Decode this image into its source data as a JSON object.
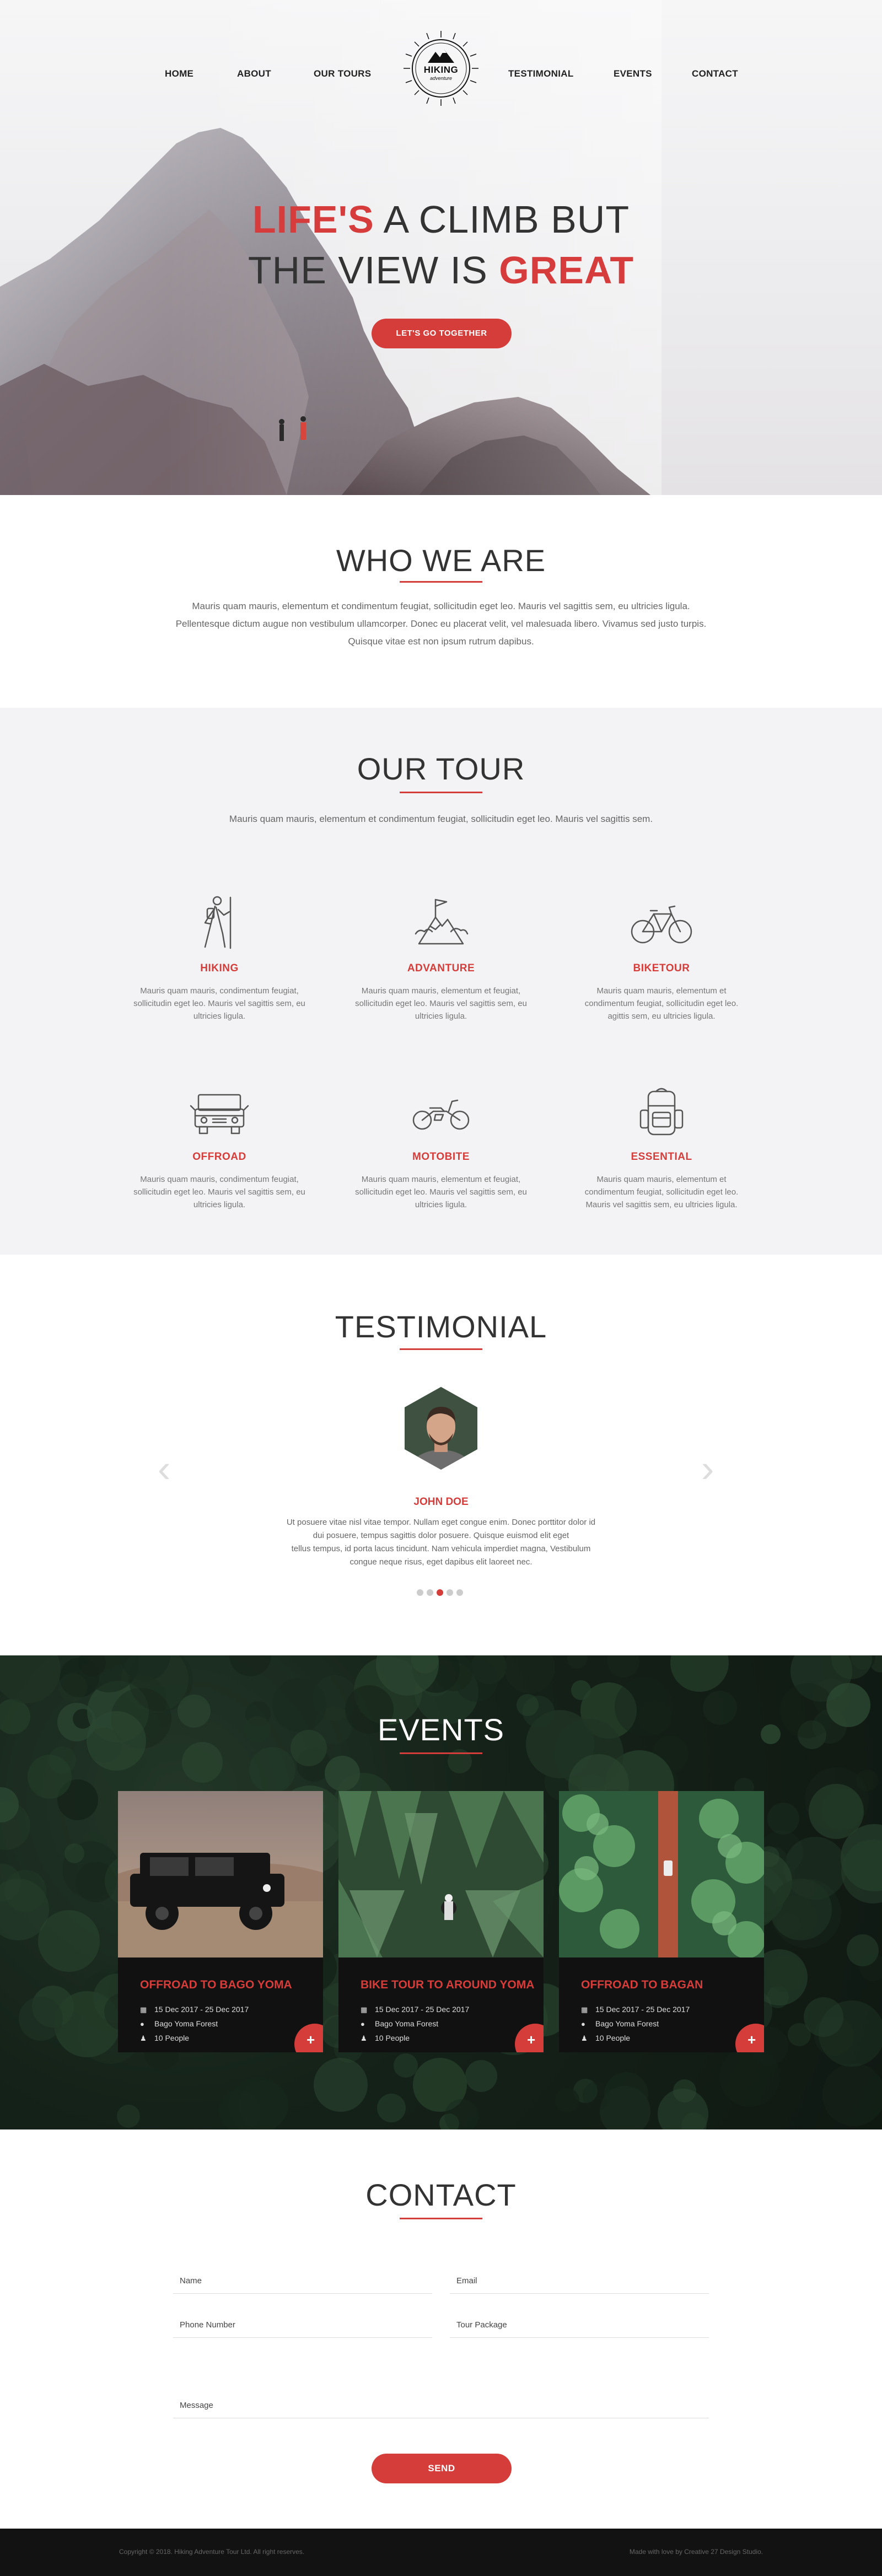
{
  "nav": {
    "items": [
      "HOME",
      "ABOUT",
      "OUR TOURS",
      "TESTIMONIAL",
      "EVENTS",
      "CONTACT"
    ],
    "logo_title": "HIKING",
    "logo_sub": "adventure"
  },
  "hero": {
    "line1_highlight": "LIFE'S",
    "line1_rest": " A CLIMB BUT",
    "line2_rest": "THE VIEW IS ",
    "line2_highlight": "GREAT",
    "button": "LET'S GO TOGETHER"
  },
  "who": {
    "title": "WHO WE ARE",
    "lines": [
      "Mauris quam mauris, elementum et condimentum feugiat, sollicitudin eget leo. Mauris vel sagittis sem, eu ultricies ligula.",
      "Pellentesque dictum augue non vestibulum ullamcorper. Donec eu placerat velit, vel malesuada libero. Vivamus sed justo turpis.",
      "Quisque vitae est non ipsum rutrum dapibus."
    ]
  },
  "tour": {
    "title": "OUR TOUR",
    "subtitle": "Mauris quam mauris, elementum et condimentum feugiat, sollicitudin eget leo. Mauris vel sagittis sem.",
    "items": [
      {
        "name": "HIKING",
        "icon": "hiker-icon",
        "desc": "Mauris quam mauris, condimentum feugiat, sollicitudin eget leo. Mauris vel sagittis sem, eu ultricies ligula."
      },
      {
        "name": "ADVANTURE",
        "icon": "mountain-flag-icon",
        "desc": "Mauris quam mauris, elementum et feugiat, sollicitudin eget leo. Mauris vel sagittis sem, eu ultricies ligula."
      },
      {
        "name": "BIKETOUR",
        "icon": "bicycle-icon",
        "desc": "Mauris quam mauris, elementum et condimentum feugiat, sollicitudin eget leo. agittis sem, eu ultricies ligula."
      },
      {
        "name": "OFFROAD",
        "icon": "jeep-icon",
        "desc": "Mauris quam mauris, condimentum feugiat, sollicitudin eget leo. Mauris vel sagittis sem, eu ultricies ligula."
      },
      {
        "name": "MOTOBITE",
        "icon": "motorbike-icon",
        "desc": "Mauris quam mauris, elementum et feugiat, sollicitudin eget leo. Mauris vel sagittis sem, eu ultricies ligula."
      },
      {
        "name": "ESSENTIAL",
        "icon": "backpack-icon",
        "desc": "Mauris quam mauris, elementum et condimentum feugiat, sollicitudin eget leo. Mauris vel sagittis sem, eu ultricies ligula."
      }
    ]
  },
  "testimonial": {
    "title": "TESTIMONIAL",
    "name": "JOHN DOE",
    "lines": [
      "Ut posuere vitae nisl vitae tempor. Nullam eget congue enim. Donec porttitor dolor id",
      "dui posuere, tempus sagittis dolor posuere. Quisque euismod elit eget",
      "tellus tempus, id porta lacus tincidunt. Nam vehicula imperdiet magna, Vestibulum",
      "congue neque risus, eget dapibus elit laoreet nec."
    ],
    "prev": "‹",
    "next": "›",
    "dots_total": 5,
    "dots_active": 3
  },
  "events": {
    "title": "EVENTS",
    "cards": [
      {
        "title": "OFFROAD TO BAGO YOMA",
        "date": "15 Dec 2017 - 25 Dec 2017",
        "place": "Bago Yoma Forest",
        "people": "10 People"
      },
      {
        "title": "BIKE TOUR TO AROUND YOMA",
        "date": "15 Dec 2017 - 25 Dec 2017",
        "place": "Bago Yoma Forest",
        "people": "10 People"
      },
      {
        "title": "OFFROAD TO BAGAN",
        "date": "15 Dec 2017 - 25 Dec 2017",
        "place": "Bago Yoma Forest",
        "people": "10 People"
      }
    ],
    "plus": "+"
  },
  "contact": {
    "title": "CONTACT",
    "fields": {
      "name": "Name",
      "email": "Email",
      "phone": "Phone Number",
      "package": "Tour Package",
      "message": "Message"
    },
    "send": "SEND"
  },
  "footer": {
    "left": "Copyright © 2018. Hiking Adventure Tour Ltd. All right reserves.",
    "right": "Made with love by Creative 27 Design Studio."
  },
  "colors": {
    "accent": "#d43d3a",
    "tour_bg": "#f3f3f5",
    "footer_bg": "#121212"
  }
}
